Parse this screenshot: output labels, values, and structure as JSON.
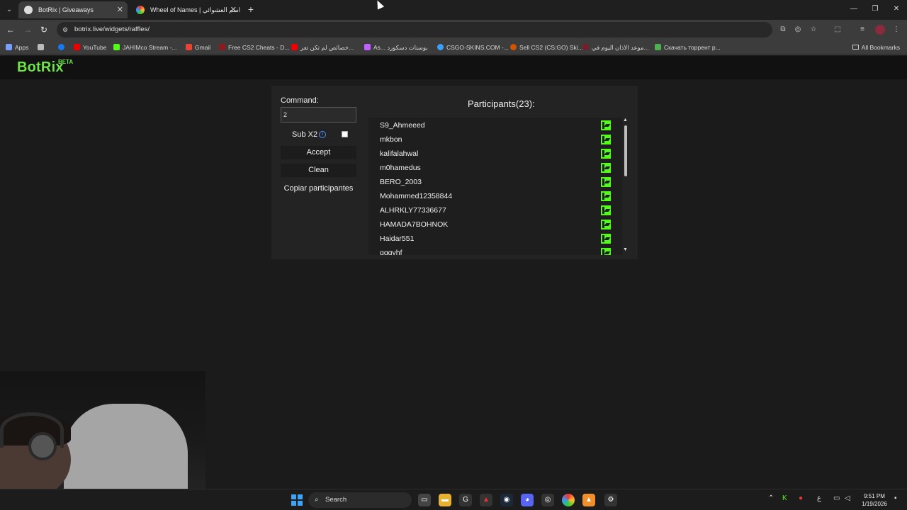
{
  "browser": {
    "tabs": [
      {
        "title": "BotRix | Giveaways",
        "active": true
      },
      {
        "title": "Wheel of Names | اسم العشوائي",
        "active": false
      }
    ],
    "url": "botrix.live/widgets/raffles/",
    "bookmarks": [
      "Apps",
      "",
      "YouTube",
      "JAHIMco Stream -...",
      "Gmail",
      "Free CS2 Cheats - D...",
      "خصائص لم تكن تعر...",
      "As... بوستات دسكورد",
      "CSGO-SKINS.COM -...",
      "Sell CS2 (CS:GO) Ski...",
      "موعد الاذان اليوم في...",
      "Скачать торрент р..."
    ],
    "all_bookmarks": "All Bookmarks"
  },
  "site": {
    "logo": "BotRix",
    "logo_badge": "BETA"
  },
  "raffle": {
    "command_label": "Command:",
    "command_value": "2",
    "sub_label": "Sub X2",
    "sub_checked": false,
    "accept_label": "Accept",
    "clean_label": "Clean",
    "copy_label": "Copiar participantes",
    "participants_title": "Participants(23):",
    "participants": [
      "S9_Ahmeeed",
      "mkbon",
      "kalifalahwal",
      "m0hamedus",
      "BERO_2003",
      "Mohammed12358844",
      "ALHRKLY77336677",
      "HAMADA7BOHNOK",
      "Haidar551",
      "gggyhf"
    ]
  },
  "taskbar": {
    "search_label": "Search",
    "time": "9:51 PM",
    "date": "1/19/2026",
    "lang": "ع"
  },
  "colors": {
    "accent": "#6fe34a",
    "kick": "#53fc18",
    "panel": "#232323"
  }
}
